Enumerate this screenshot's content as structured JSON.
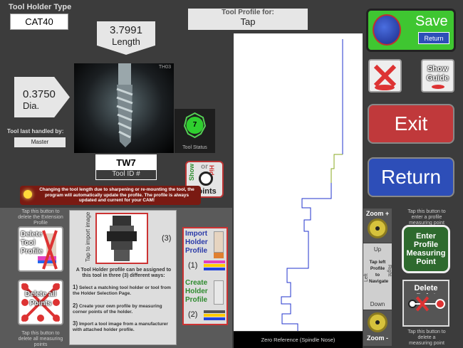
{
  "tool_holder": {
    "heading": "Tool Holder Type",
    "value": "CAT40"
  },
  "length": {
    "value": "3.7991",
    "label": "Length"
  },
  "diameter": {
    "value": "0.3750",
    "label": "Dia."
  },
  "profile_for": {
    "heading": "Tool Profile for:",
    "value": "Tap"
  },
  "last_handled": {
    "heading": "Tool last handled by:",
    "value": "Master"
  },
  "tool_image": {
    "corner": "TH03",
    "status_number": "7",
    "status_label": "Tool Status"
  },
  "tool_id": {
    "value": "TW7",
    "label": "Tool ID #"
  },
  "show_hide": {
    "show": "Show",
    "or": "or",
    "hide": "Hide",
    "points": "Points"
  },
  "notice": "Changing the tool length due to sharpening or re-mounting the tool, the program will automatically update the profile. The profile is always updated and current for your CAM!",
  "save_button": {
    "label": "Save",
    "return_label": "Return"
  },
  "show_guide_button": {
    "label": "Show Guide"
  },
  "exit_button": {
    "label": "Exit"
  },
  "return_button": {
    "label": "Return"
  },
  "delete_tool_profile": {
    "hint": "Tap this button to delete the Extension Profile",
    "label": "Delete Tool Profile"
  },
  "delete_all_points": {
    "label": "Delete all Points",
    "hint": "Tap this button to delete all measuring points"
  },
  "holder_panel": {
    "tap_label": "Tap to import image",
    "option_number": "(3)",
    "intro": "A Tool Holder profile can be assigned to this tool in three (3) different ways:",
    "steps": [
      {
        "num": "1)",
        "text": "Select a matching tool holder or tool from the Holder Selection Page."
      },
      {
        "num": "2)",
        "text": "Create your own profile by measuring corner points of the holder."
      },
      {
        "num": "3)",
        "text": "Import a tool image from a manufacturer with attached holder profile."
      }
    ]
  },
  "import_holder": {
    "label": "Import Holder Profile",
    "number": "(1)"
  },
  "create_holder": {
    "label": "Create Holder Profile",
    "number": "(2)"
  },
  "profile_view": {
    "footer": "Zero Reference (Spindle Nose)"
  },
  "zoom": {
    "plus": "Zoom +",
    "minus": "Zoom -",
    "up": "Up",
    "down": "Down",
    "left": "Left",
    "right": "Right",
    "center": "Tap left Profile to Navigate"
  },
  "enter_point": {
    "hint": "Tap this button to enter a profile measuring point",
    "label": "Enter Profile Measuring Point"
  },
  "delete_point": {
    "label": "Delete Point",
    "hint": "Tap this button to delete a measuring point"
  },
  "colors": {
    "panel": "#3c3c3c",
    "exit_red": "#c0393b",
    "return_blue": "#2d4eb8",
    "save_green": "#3fc631",
    "notice_bg": "#7a1a12",
    "profile_blue": "#2233cc",
    "profile_green": "#88aa22"
  }
}
